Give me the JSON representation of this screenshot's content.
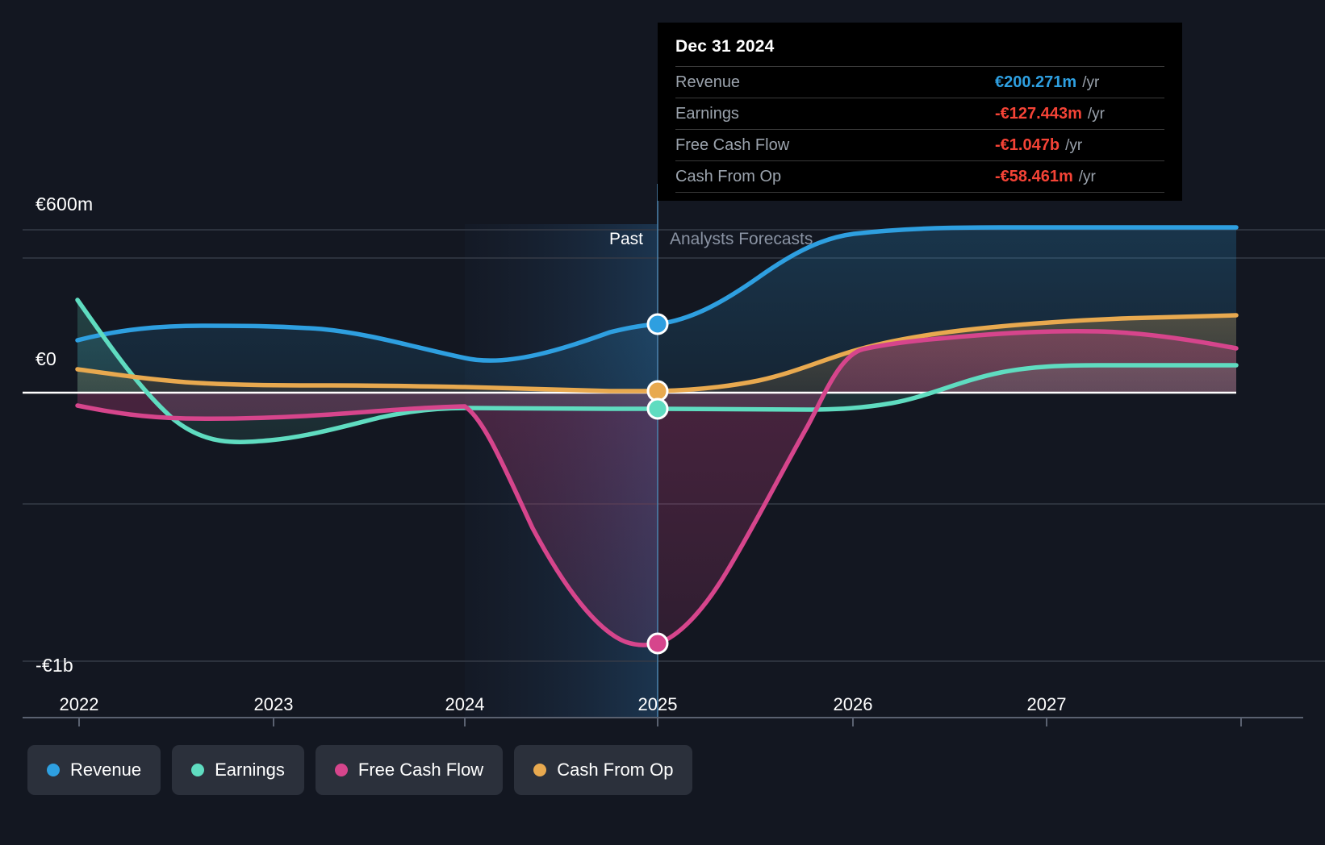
{
  "chart_data": {
    "type": "line",
    "title": "",
    "xlabel": "",
    "ylabel": "",
    "currency": "EUR",
    "units": "millions",
    "grid": true,
    "legend_position": "bottom-left",
    "x_tick_labels": [
      "2022",
      "2023",
      "2024",
      "2025",
      "2026",
      "2027"
    ],
    "y_tick_labels": [
      "€600m",
      "€0",
      "-€1b"
    ],
    "ylim": [
      -1000,
      600
    ],
    "zero_line": 0,
    "past_forecast_split_year": 2025,
    "annotations": [
      {
        "text": "Past",
        "position": "left-of-split"
      },
      {
        "text": "Analysts Forecasts",
        "position": "right-of-split"
      }
    ],
    "series": [
      {
        "name": "Revenue",
        "color": "#2e9fe0",
        "marker_value_at_2025": 200.271,
        "x": [
          2022,
          2022.5,
          2023,
          2023.5,
          2024,
          2024.5,
          2025,
          2025.5,
          2026,
          2026.5,
          2027,
          2027.8
        ],
        "values": [
          150,
          172,
          172,
          140,
          105,
          130,
          200.271,
          330,
          450,
          540,
          568,
          572
        ]
      },
      {
        "name": "Earnings",
        "color": "#5fdcc0",
        "marker_value_at_2025": -127.443,
        "x": [
          2022,
          2022.5,
          2023,
          2023.5,
          2024,
          2024.5,
          2025,
          2025.5,
          2026,
          2026.5,
          2027,
          2027.8
        ],
        "values": [
          330,
          10,
          -180,
          -200,
          -150,
          -128,
          -127.443,
          -128,
          -125,
          -55,
          -5,
          -3
        ]
      },
      {
        "name": "Free Cash Flow",
        "color": "#d6458c",
        "marker_value_at_2025": -1047,
        "x": [
          2022,
          2022.5,
          2023,
          2023.5,
          2024,
          2024.5,
          2025,
          2025.5,
          2026,
          2026.5,
          2027,
          2027.8
        ],
        "values": [
          -110,
          -135,
          -135,
          -125,
          -105,
          -560,
          -1047,
          -600,
          55,
          130,
          160,
          130
        ]
      },
      {
        "name": "Cash From Op",
        "color": "#e8a94f",
        "marker_value_at_2025": -58.461,
        "x": [
          2022,
          2022.5,
          2023,
          2023.5,
          2024,
          2024.5,
          2025,
          2025.5,
          2026,
          2026.5,
          2027,
          2027.8
        ],
        "values": [
          -5,
          -40,
          -50,
          -48,
          -45,
          -50,
          -58.461,
          -20,
          60,
          125,
          155,
          170
        ]
      }
    ]
  },
  "tooltip": {
    "date": "Dec 31 2024",
    "rows": [
      {
        "name": "Revenue",
        "value": "€200.271m",
        "unit": "/yr",
        "color": "#2e9fe0"
      },
      {
        "name": "Earnings",
        "value": "-€127.443m",
        "unit": "/yr",
        "color": "#f44336"
      },
      {
        "name": "Free Cash Flow",
        "value": "-€1.047b",
        "unit": "/yr",
        "color": "#f44336"
      },
      {
        "name": "Cash From Op",
        "value": "-€58.461m",
        "unit": "/yr",
        "color": "#f44336"
      }
    ]
  },
  "axis": {
    "y_top": "€600m",
    "y_zero": "€0",
    "y_bottom": "-€1b",
    "x": [
      "2022",
      "2023",
      "2024",
      "2025",
      "2026",
      "2027"
    ]
  },
  "bands": {
    "past": "Past",
    "forecast": "Analysts Forecasts"
  },
  "legend": [
    {
      "label": "Revenue",
      "color": "#2e9fe0"
    },
    {
      "label": "Earnings",
      "color": "#5fdcc0"
    },
    {
      "label": "Free Cash Flow",
      "color": "#d6458c"
    },
    {
      "label": "Cash From Op",
      "color": "#e8a94f"
    }
  ]
}
